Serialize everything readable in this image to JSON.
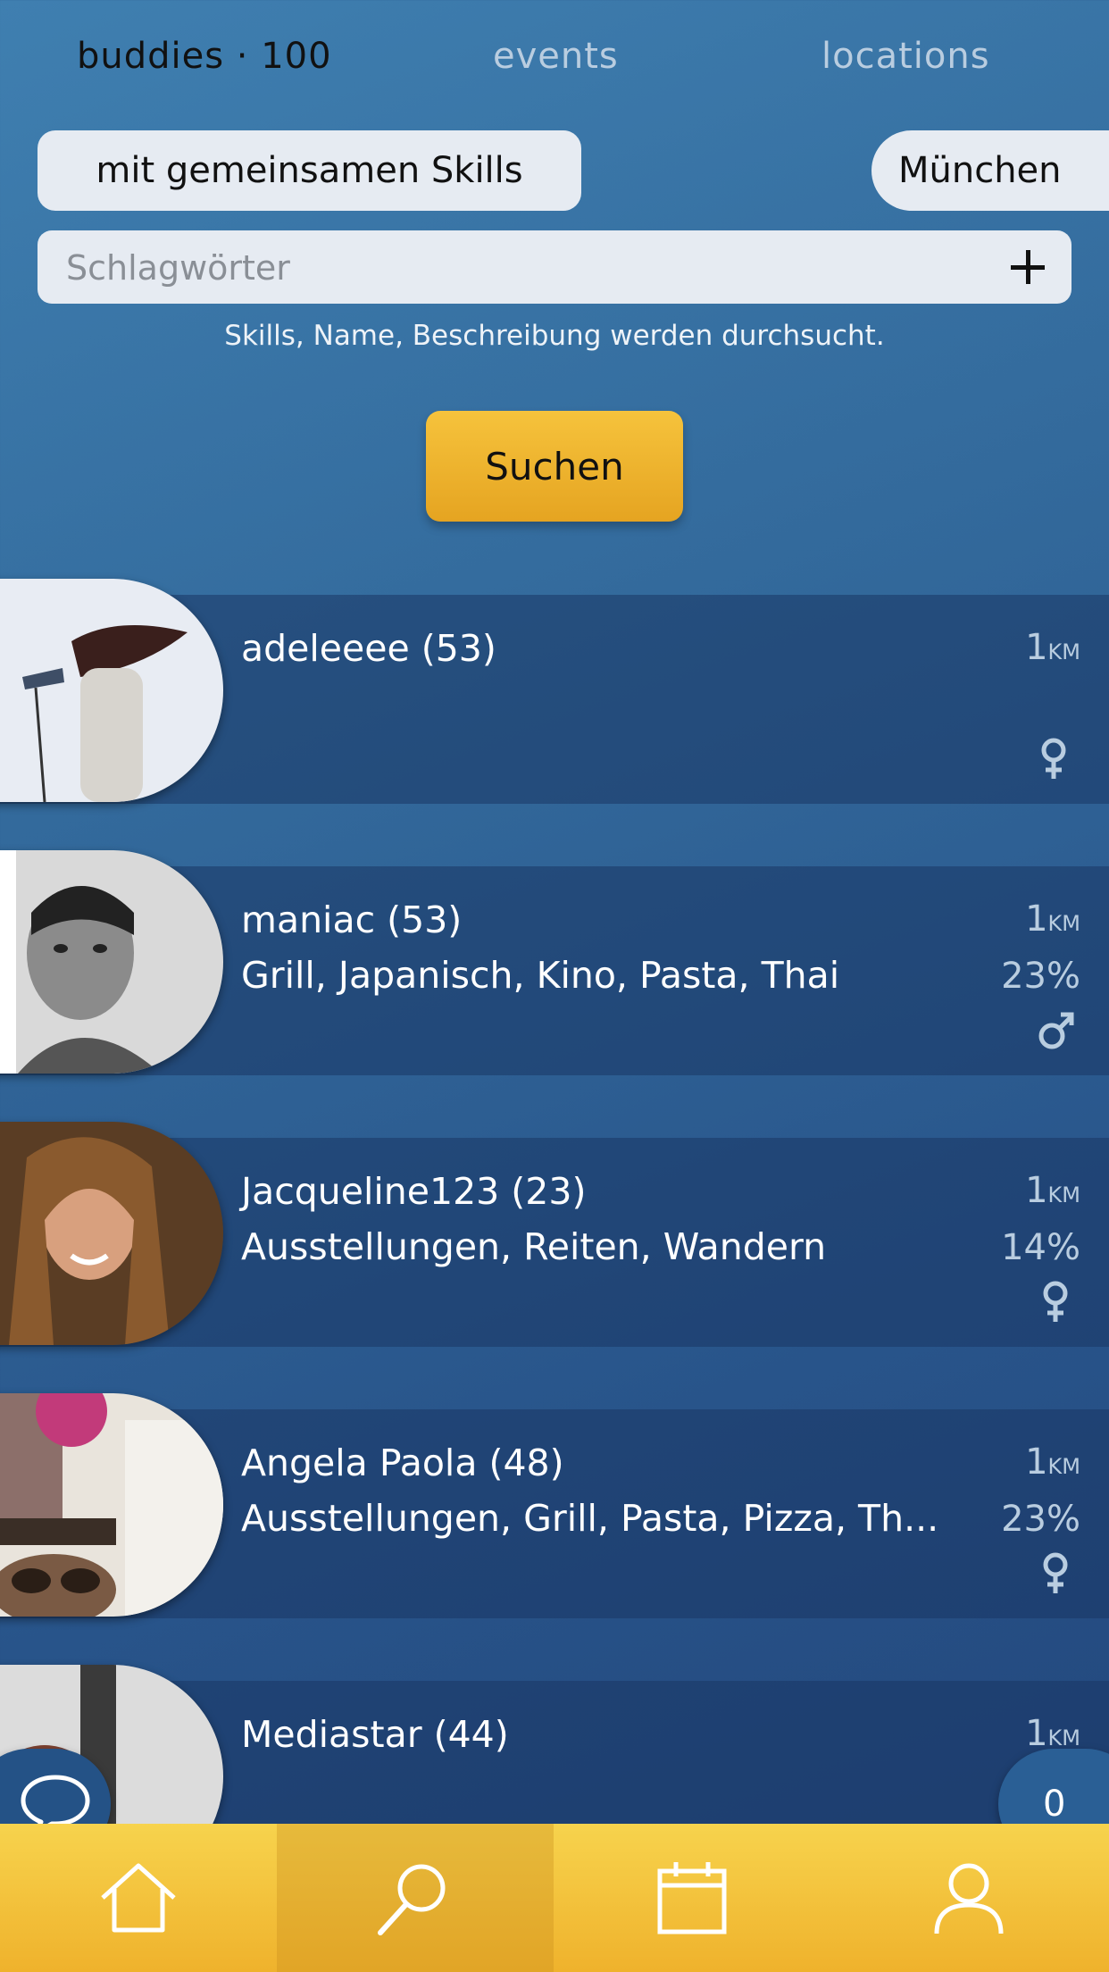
{
  "tabs": [
    {
      "label": "buddies · 100"
    },
    {
      "label": "events"
    },
    {
      "label": "locations"
    }
  ],
  "filters": {
    "skills_filter": "mit gemeinsamen Skills",
    "city": "München"
  },
  "search": {
    "placeholder": "Schlagwörter",
    "value": "",
    "hint": "Skills, Name, Beschreibung werden durchsucht.",
    "button_label": "Suchen"
  },
  "results": [
    {
      "name": "adeleeee (53)",
      "skills": "",
      "distance": "1",
      "distance_unit": "KM",
      "match": "",
      "gender": "female"
    },
    {
      "name": "maniac (53)",
      "skills": "Grill, Japanisch, Kino, Pasta, Thai",
      "distance": "1",
      "distance_unit": "KM",
      "match": "23%",
      "gender": "male"
    },
    {
      "name": "Jacqueline123 (23)",
      "skills": "Ausstellungen, Reiten, Wandern",
      "distance": "1",
      "distance_unit": "KM",
      "match": "14%",
      "gender": "female"
    },
    {
      "name": "Angela Paola (48)",
      "skills": "Ausstellungen, Grill, Pasta, Pizza, Th...",
      "distance": "1",
      "distance_unit": "KM",
      "match": "23%",
      "gender": "female"
    },
    {
      "name": "Mediastar (44)",
      "skills": "",
      "distance": "1",
      "distance_unit": "KM",
      "match": "",
      "gender": ""
    }
  ],
  "chat_count": "0",
  "nav": [
    {
      "icon": "home-icon"
    },
    {
      "icon": "search-icon"
    },
    {
      "icon": "calendar-icon"
    },
    {
      "icon": "profile-icon"
    }
  ]
}
